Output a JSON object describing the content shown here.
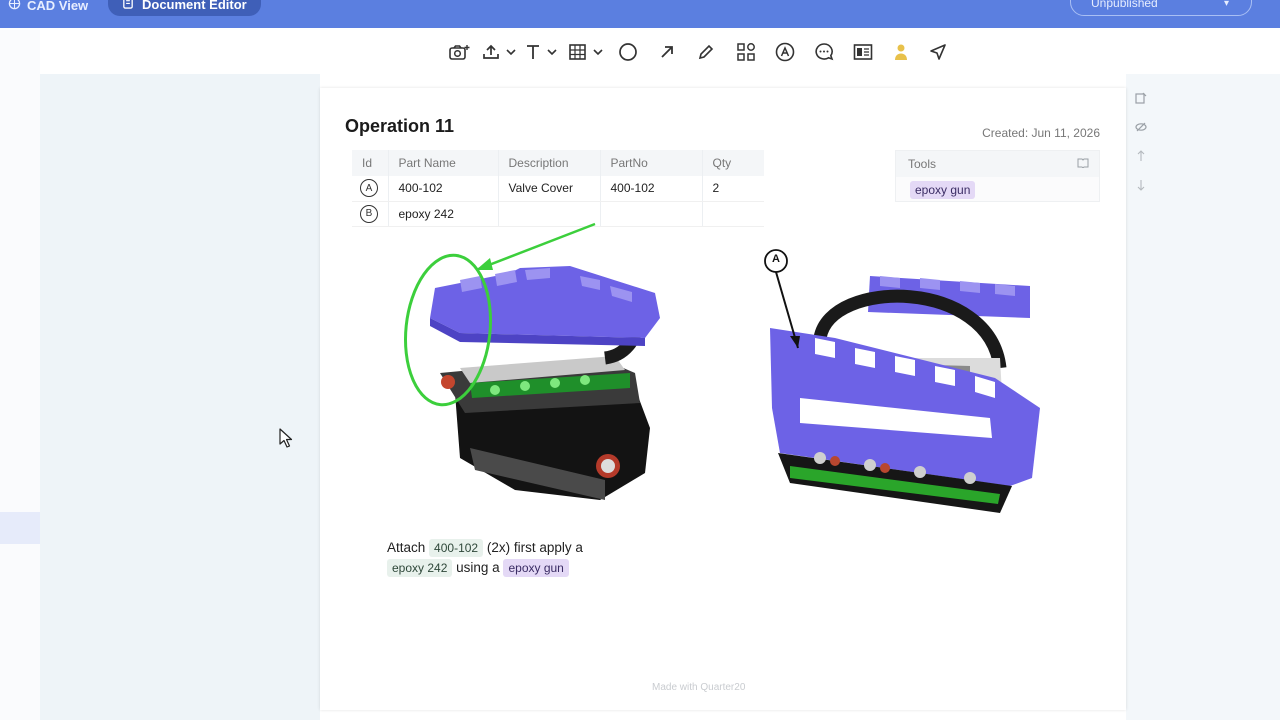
{
  "header": {
    "tabs": [
      {
        "label": "CAD View"
      },
      {
        "label": "Document Editor"
      }
    ],
    "publish_status": "Unpublished"
  },
  "toolbar": {
    "tools": [
      {
        "icon": "camera-plus-icon"
      },
      {
        "icon": "upload-icon"
      },
      {
        "icon": "text-icon"
      },
      {
        "icon": "table-icon"
      },
      {
        "icon": "circle-icon"
      },
      {
        "icon": "arrow-icon"
      },
      {
        "icon": "pencil-icon"
      },
      {
        "icon": "shapes-icon"
      },
      {
        "icon": "label-a-icon"
      },
      {
        "icon": "comment-icon"
      },
      {
        "icon": "layout-icon"
      },
      {
        "icon": "person-icon"
      },
      {
        "icon": "send-icon"
      }
    ]
  },
  "document": {
    "title": "Operation 11",
    "created": "Created: Jun 11, 2026",
    "parts_table": {
      "columns": [
        "Id",
        "Part Name",
        "Description",
        "PartNo",
        "Qty"
      ],
      "rows": [
        {
          "id": "A",
          "part_name": "400-102",
          "description": "Valve Cover",
          "part_no": "400-102",
          "qty": "2"
        },
        {
          "id": "B",
          "part_name": "epoxy 242",
          "description": "",
          "part_no": "",
          "qty": ""
        }
      ]
    },
    "tools_box": {
      "header": "Tools",
      "items": [
        "epoxy gun"
      ]
    },
    "image_label": "A",
    "instruction": {
      "t1": "Attach",
      "part1": "400-102",
      "t2": "(2x) first apply a",
      "part2": "epoxy 242",
      "t3": "using a",
      "tool": "epoxy gun"
    },
    "footer": "Made with  Quarter20"
  },
  "colors": {
    "header_bg": "#5b7fe0",
    "active_tab_bg": "#3f5fb8",
    "part_purple": "#6d62e6",
    "annotation_green": "#3ccf3c",
    "tool_chip_bg": "#e4d9f6",
    "part_chip_bg": "#e8f1ec"
  }
}
